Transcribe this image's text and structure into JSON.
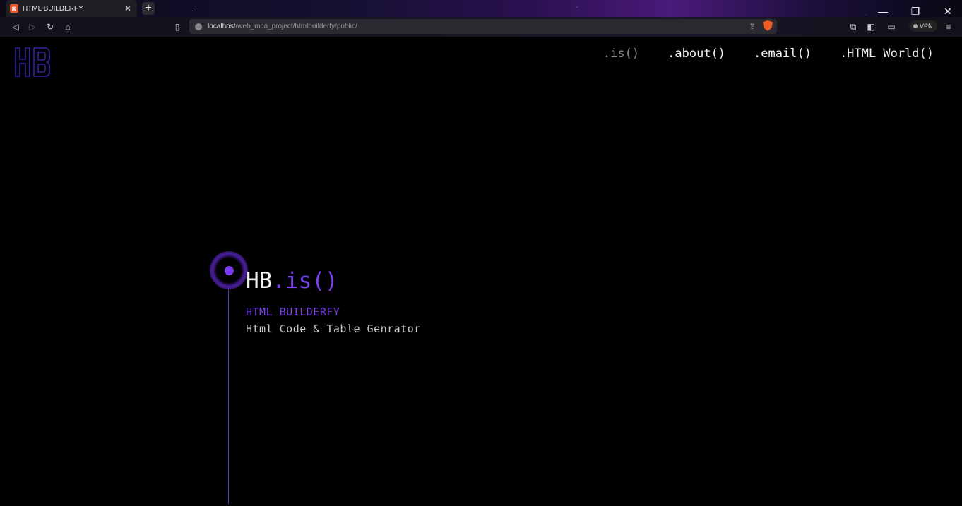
{
  "browser": {
    "tab": {
      "title": "HTML BUILDERFY",
      "favicon": "xampp-icon"
    },
    "url": {
      "host": "localhost",
      "path": "/web_mca_project/htmlbuilderfy/public/"
    },
    "vpn_label": "VPN"
  },
  "page": {
    "logo": "HB",
    "nav": [
      ".is()",
      ".about()",
      ".email()",
      ".HTML World()"
    ],
    "hero": {
      "title_main": "HB",
      "title_accent": ".is()",
      "subtitle": "HTML BUILDERFY",
      "description": "Html Code & Table Genrator"
    }
  },
  "colors": {
    "accent": "#7b3ff2",
    "background": "#000000"
  }
}
